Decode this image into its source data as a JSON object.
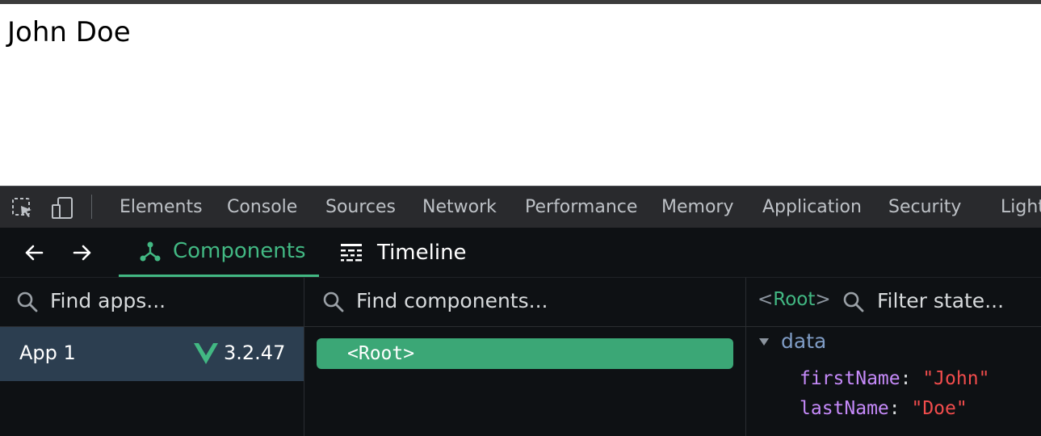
{
  "page": {
    "text": "John Doe"
  },
  "devtools": {
    "tabs": [
      "Elements",
      "Console",
      "Sources",
      "Network",
      "Performance",
      "Memory",
      "Application",
      "Security",
      "Light"
    ]
  },
  "vue": {
    "nav": {
      "back_icon": "arrow-left-icon",
      "forward_icon": "arrow-right-icon"
    },
    "tabs": [
      {
        "label": "Components",
        "icon": "component-tree-icon",
        "active": true
      },
      {
        "label": "Timeline",
        "icon": "timeline-icon",
        "active": false
      }
    ],
    "apps": {
      "search_placeholder": "Find apps...",
      "items": [
        {
          "name": "App 1",
          "version": "3.2.47"
        }
      ]
    },
    "components": {
      "search_placeholder": "Find components...",
      "root": "<Root>"
    },
    "state": {
      "selected": "Root",
      "bracket_open": "<",
      "bracket_close": ">",
      "search_placeholder": "Filter state...",
      "section": "data",
      "props": [
        {
          "key": "firstName",
          "value": "\"John\""
        },
        {
          "key": "lastName",
          "value": "\"Doe\""
        }
      ]
    },
    "colors": {
      "accent": "#42b883",
      "selected_row": "#2c3e50",
      "string_value": "#f14c4c",
      "key": "#c58af9"
    }
  }
}
